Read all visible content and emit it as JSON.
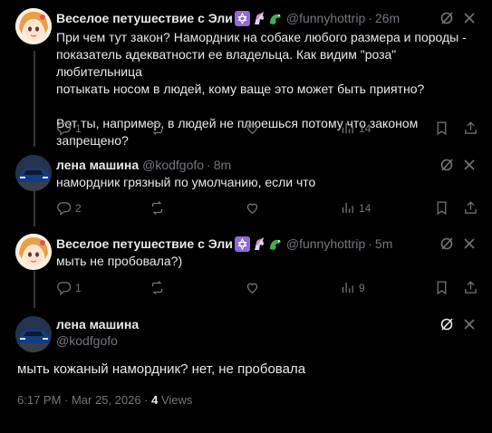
{
  "tweets": [
    {
      "name": "Веселое петушествие с Эли",
      "handle": "@funnyhottrip",
      "dot": "·",
      "time": "26m",
      "lines": [
        "При чем тут закон? Намордник на собаке любого размера и породы -",
        "показатель адекватности ее владельца. Как видим \"роза\" любительница",
        "потыкать носом в людей, кому ваще это может быть приятно?",
        "",
        "Вот ты, например, в людей не плюешься потому что законом запрещено?"
      ],
      "replies": "1",
      "views": "14",
      "avatar": "anime-girl-avatar"
    },
    {
      "name": "лена машина",
      "handle": "@kodfgofo",
      "dot": "·",
      "time": "8m",
      "lines": [
        "намордник грязный по умолчанию, если что"
      ],
      "replies": "2",
      "views": "14",
      "avatar": "car-avatar"
    },
    {
      "name": "Веселое петушествие с Эли",
      "handle": "@funnyhottrip",
      "dot": "·",
      "time": "5m",
      "lines": [
        "мыть не пробовала?)"
      ],
      "replies": "1",
      "views": "9",
      "avatar": "anime-girl-avatar"
    }
  ],
  "main": {
    "name": "лена машина",
    "handle": "@kodfgofo",
    "text": "мыть кожаный намордник? нет, не пробовала",
    "time": "6:17 PM · Mar 25, 2026 · ",
    "views_count": "4",
    "views_label": " Views"
  },
  "colors": {
    "bg": "#000000",
    "text": "#e7e9ea",
    "muted": "#71767b",
    "divider": "#2f3336"
  }
}
